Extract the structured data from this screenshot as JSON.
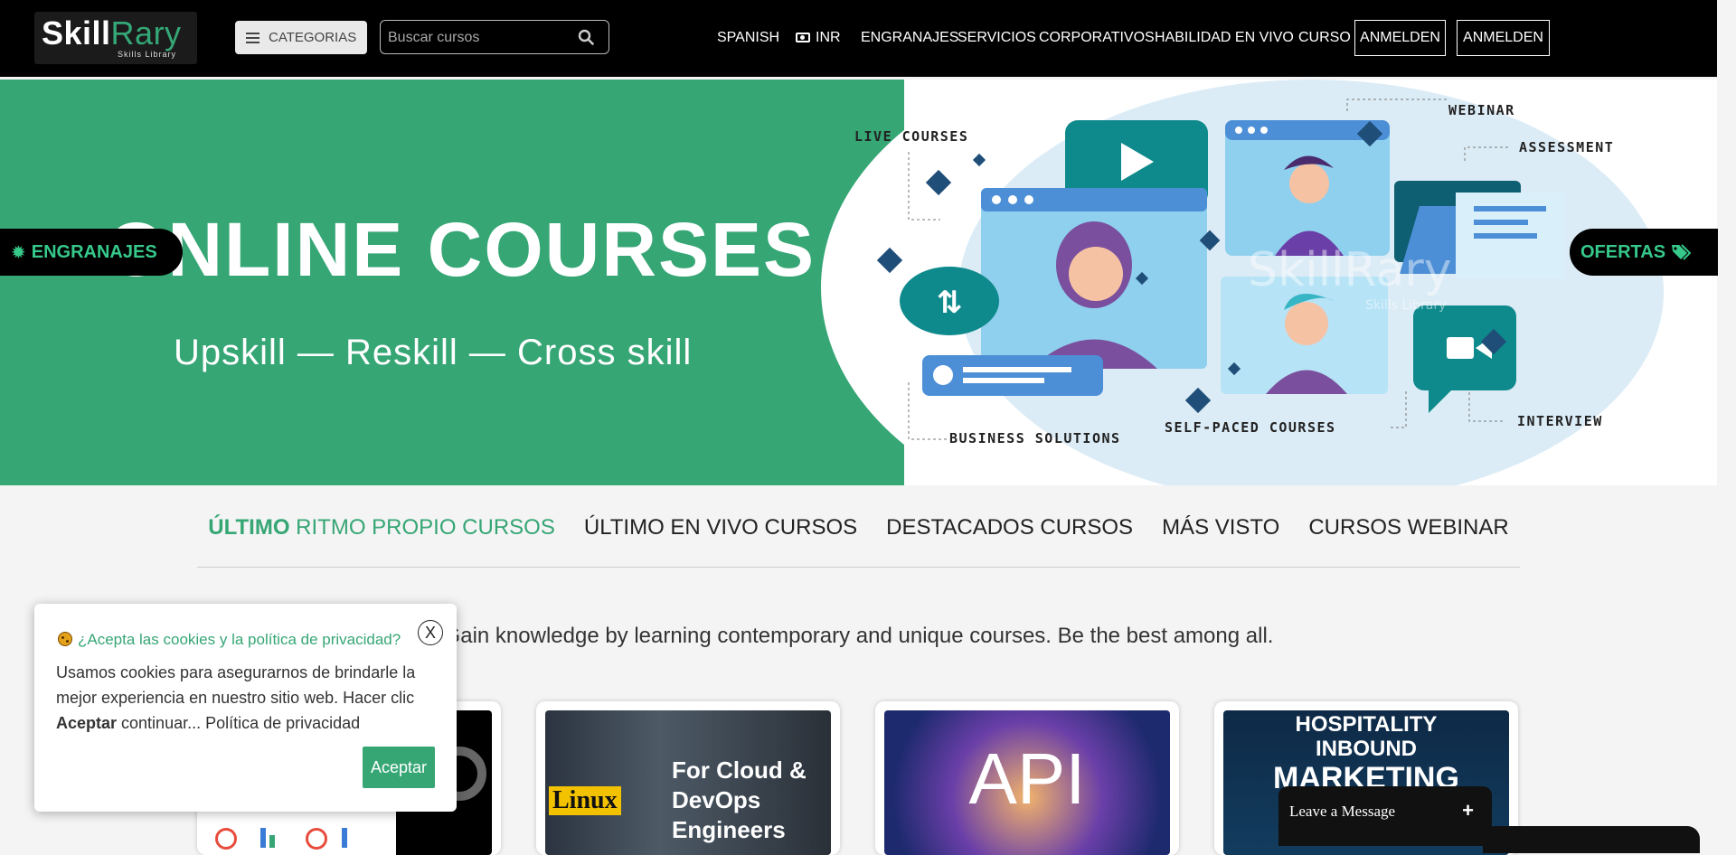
{
  "header": {
    "logo_main": "Skill",
    "logo_accent": "Rary",
    "logo_sub": "Skills Library",
    "categories_label": "CATEGORIAS",
    "search_placeholder": "Buscar cursos",
    "nav": {
      "language": "SPANISH",
      "currency": "INR",
      "items": [
        "ENGRANAJES",
        "SERVICIOS",
        "CORPORATIVOS",
        "HABILIDAD EN VIVO",
        "CURSO"
      ],
      "login_1": "ANMELDEN",
      "login_2": "ANMELDEN"
    }
  },
  "hero": {
    "title": "ONLINE COURSES",
    "subtitle": "Upskill  —  Reskill  —  Cross skill",
    "art_labels": {
      "live": "LIVE COURSES",
      "webinar": "WEBINAR",
      "assessment": "ASSESSMENT",
      "business": "BUSINESS SOLUTIONS",
      "self_paced": "SELF-PACED COURSES",
      "interview": "INTERVIEW",
      "watermark": "SkillRary",
      "watermark_sub": "Skills Library"
    },
    "side_left": "ENGRANAJES",
    "side_right": "OFERTAS"
  },
  "tabs": {
    "active_bold": "ÚLTIMO",
    "active_rest": " RITMO PROPIO CURSOS",
    "items": [
      "ÚLTIMO EN VIVO CURSOS",
      "DESTACADOS CURSOS",
      "MÁS VISTO",
      "CURSOS WEBINAR"
    ]
  },
  "tagline": "Gain knowledge by learning contemporary and unique courses. Be the best among all.",
  "cards": [
    {
      "thumb_text": ""
    },
    {
      "thumb_line1": "For Cloud &",
      "thumb_line2": "DevOps",
      "thumb_line3": "Engineers",
      "logo": "Linux"
    },
    {
      "thumb_text": "API"
    },
    {
      "thumb_line1": "HOSPITALITY",
      "thumb_line2": "INBOUND",
      "thumb_line3": "MARKETING"
    }
  ],
  "cookie": {
    "title": "¿Acepta las cookies y la política de privacidad?",
    "close": "X",
    "body_1": "Usamos cookies para asegurarnos de brindarle la mejor experiencia en nuestro sitio web. Hacer clic ",
    "body_bold": "Aceptar",
    "body_2": " continuar... Política de privacidad",
    "accept": "Aceptar"
  },
  "chat": {
    "label": "Leave a Message",
    "plus": "+"
  },
  "colors": {
    "brand_green": "#36a675",
    "header_bg": "#000000",
    "side_tab_text": "#36c98a"
  }
}
